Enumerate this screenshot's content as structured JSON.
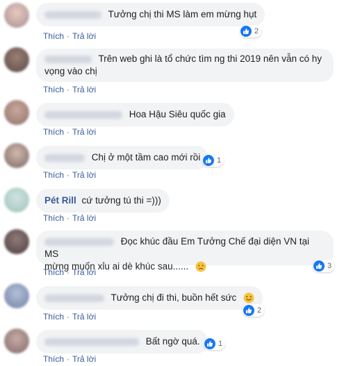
{
  "actions": {
    "like_label": "Thích",
    "reply_label": "Trả lời"
  },
  "comments": [
    {
      "text": "Tưởng chị thi MS làm em mừng hụt",
      "reactions": "2"
    },
    {
      "text_line1": "Trên web ghi là tổ chức tìm ng thi 2019 nên vẫn có hy",
      "text_line2": "vọng vào chị"
    },
    {
      "text": "Hoa Hậu Siêu quốc gia"
    },
    {
      "text": "Chị ở một tầm cao mới rồi",
      "reactions": "1"
    },
    {
      "author": "Pét Rill",
      "text": "cứ tưởng tú thi =)))"
    },
    {
      "text_line1": "Đọc khúc đầu Em Tưởng Chế đại diện VN tại MS",
      "text_line2": "mừng muốn xỉu ai dè khúc sau......",
      "reactions": "3",
      "emoji": "confused-face-icon"
    },
    {
      "text": "Tưởng chị đi thi, buồn hết sức",
      "reactions": "2",
      "emoji": "smiling-face-icon"
    },
    {
      "text": "Bất ngờ quá.",
      "reactions": "1"
    }
  ],
  "colors": {
    "link": "#385898",
    "bubble": "#f2f3f5",
    "like_blue": "#1877f2"
  }
}
